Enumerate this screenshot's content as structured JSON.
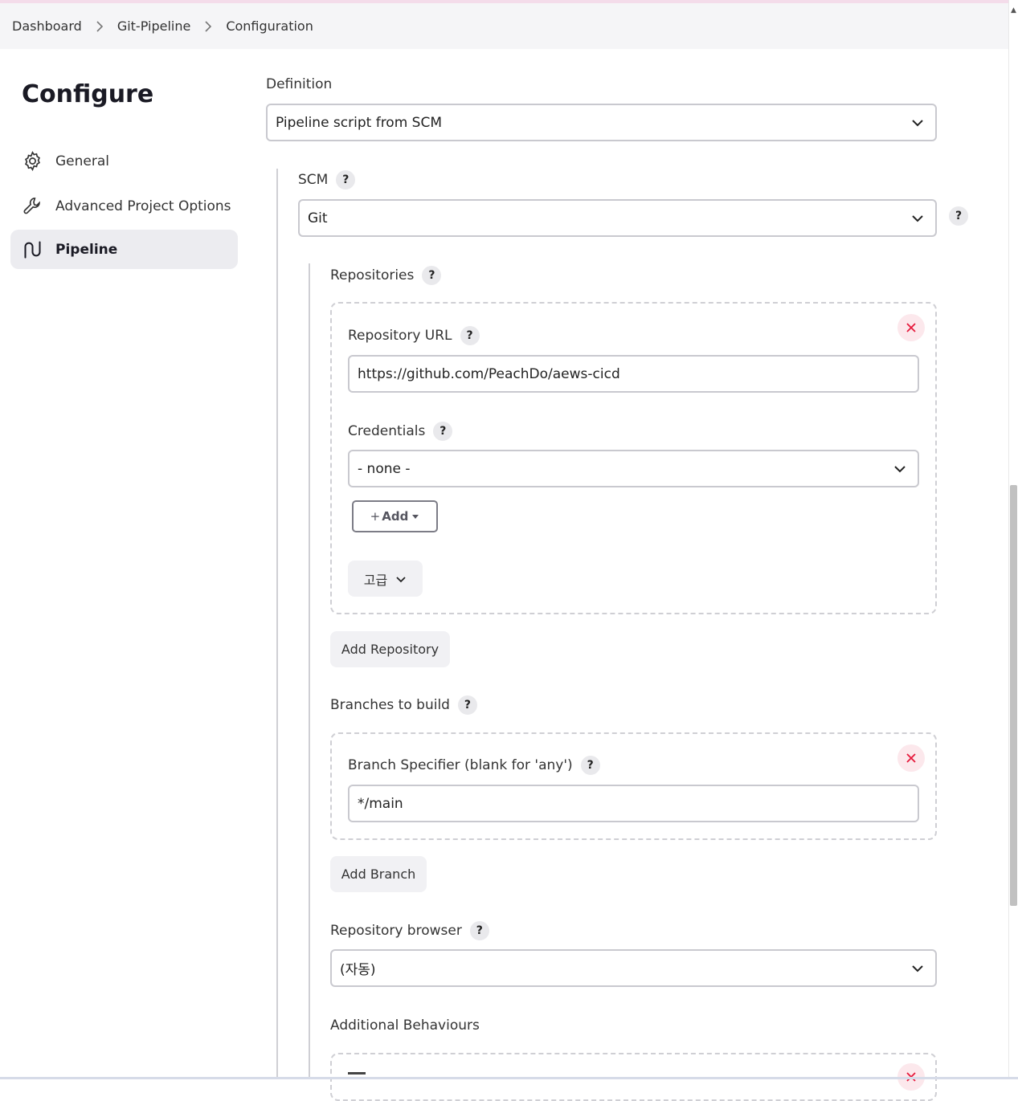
{
  "breadcrumb": {
    "items": [
      "Dashboard",
      "Git-Pipeline",
      "Configuration"
    ]
  },
  "sidebar": {
    "title": "Configure",
    "items": [
      {
        "label": "General",
        "icon": "gear-icon"
      },
      {
        "label": "Advanced Project Options",
        "icon": "wrench-icon"
      },
      {
        "label": "Pipeline",
        "icon": "pipeline-icon",
        "active": true
      }
    ]
  },
  "definition": {
    "label": "Definition",
    "value": "Pipeline script from SCM"
  },
  "scm": {
    "label": "SCM",
    "help": "?",
    "value": "Git"
  },
  "repositories": {
    "label": "Repositories",
    "help": "?",
    "repo_url_label": "Repository URL",
    "repo_url_value": "https://github.com/PeachDo/aews-cicd",
    "credentials_label": "Credentials",
    "credentials_value": "- none -",
    "add_label": "Add",
    "advanced_label": "고급",
    "add_repository_label": "Add Repository"
  },
  "branches": {
    "label": "Branches to build",
    "specifier_label": "Branch Specifier (blank for 'any')",
    "specifier_value": "*/main",
    "add_branch_label": "Add Branch"
  },
  "repository_browser": {
    "label": "Repository browser",
    "value": "(자동)"
  },
  "additional_behaviours": {
    "label": "Additional Behaviours"
  },
  "colors": {
    "danger": "#e6193c",
    "active_bg": "#ececf0"
  }
}
